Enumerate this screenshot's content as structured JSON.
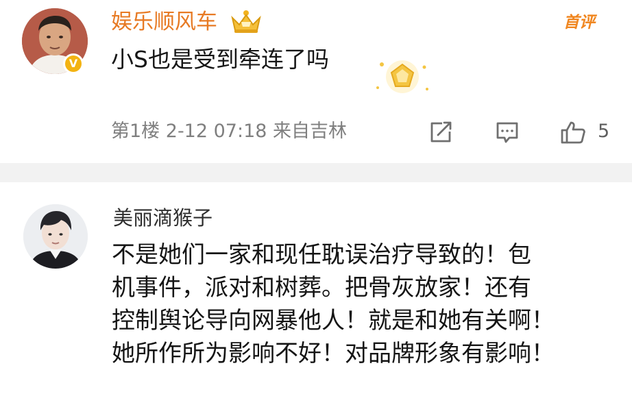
{
  "comment_1": {
    "username": "娱乐顺风车",
    "badge": "首评",
    "content": "小S也是受到牵连了吗",
    "meta": "第1楼 2-12 07:18 来自吉林",
    "like_count": "5",
    "icons": [
      "verified-icon",
      "crown-icon",
      "sparkle-icon",
      "share-icon",
      "comment-icon",
      "like-icon"
    ],
    "colors": {
      "username": "#e77a24",
      "badge": "#f0861f",
      "verified": "#f3b312"
    }
  },
  "comment_2": {
    "username": "美丽滴猴子",
    "content_lines": [
      "不是她们一家和现任耽误治疗导致的！包",
      "机事件，派对和树葬。把骨灰放家！还有",
      "控制舆论导向网暴他人！就是和她有关啊！",
      "她所作所为影响不好！对品牌形象有影响！"
    ]
  }
}
